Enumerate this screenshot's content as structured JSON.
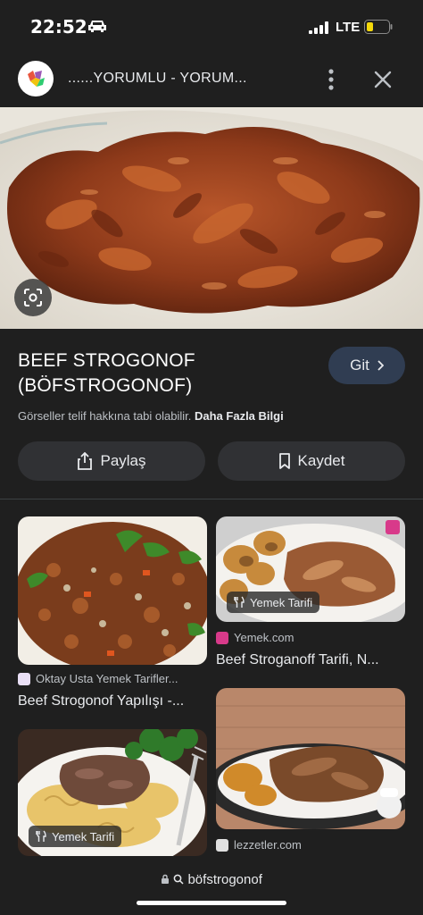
{
  "status_bar": {
    "time": "22:52",
    "network": "LTE"
  },
  "header": {
    "title": "......YORUMLU - YORUM..."
  },
  "result": {
    "title": "BEEF STROGONOF\n(BÖFSTROGONOF)",
    "visit_label": "Git",
    "copyright_text": "Görseller telif hakkına tabi olabilir.",
    "more_info": "Daha Fazla Bilgi",
    "share_label": "Paylaş",
    "save_label": "Kaydet"
  },
  "related": [
    {
      "source": "Oktay Usta Yemek Tarifler...",
      "title": "Beef Strogonof Yapılışı -...",
      "badge": ""
    },
    {
      "source": "Yemek.com",
      "title": "Beef Stroganoff Tarifi, N...",
      "badge": "Yemek Tarifi"
    },
    {
      "source": "",
      "title": "",
      "badge": "Yemek Tarifi"
    },
    {
      "source": "lezzetler.com",
      "title": "",
      "badge": ""
    }
  ],
  "bottom_bar": {
    "url": "böfstrogonof"
  },
  "colors": {
    "background": "#1f1f1f",
    "button": "#303134",
    "visit_button": "#303d52",
    "battery": "#f5d90a"
  }
}
